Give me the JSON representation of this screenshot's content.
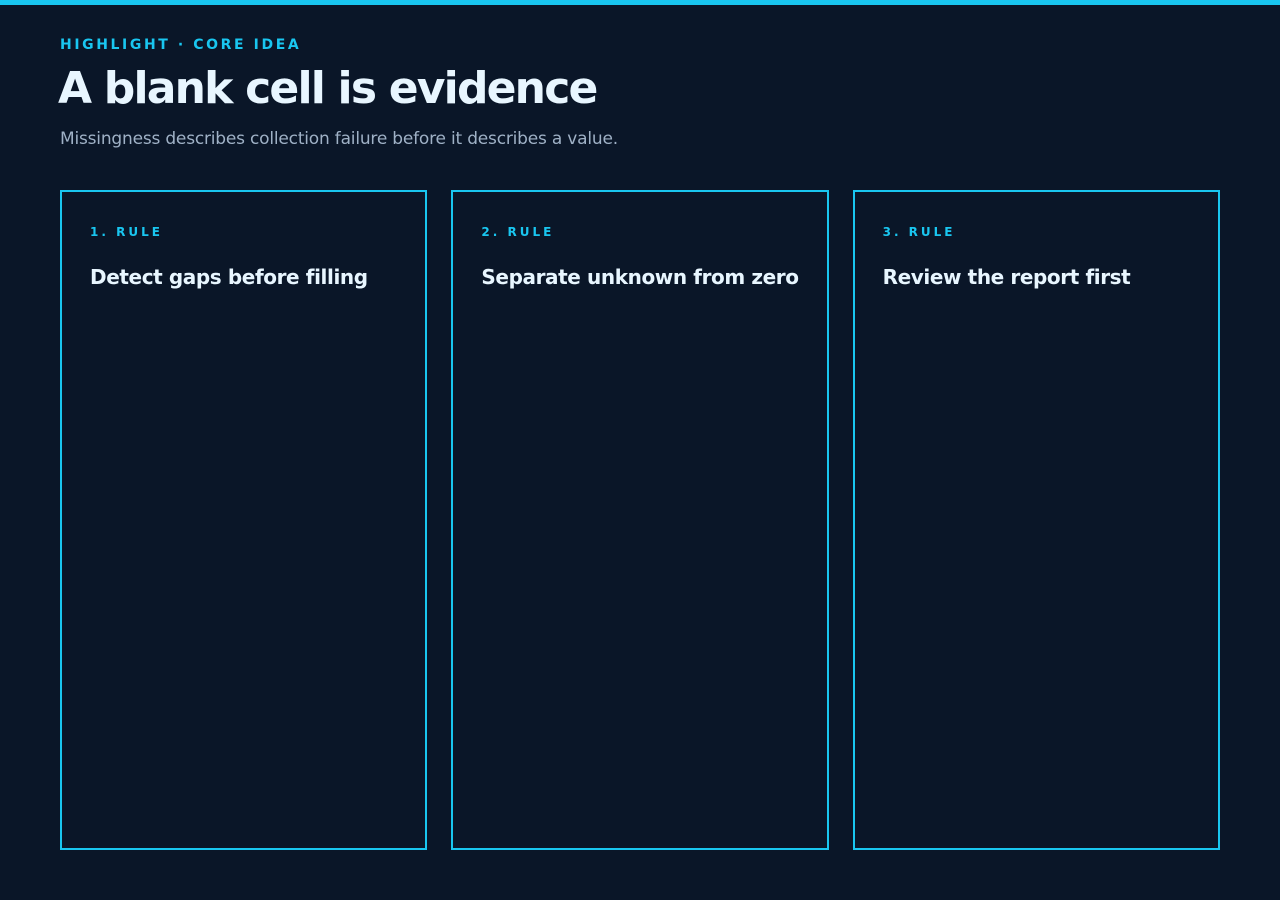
{
  "header": {
    "eyebrow": "HIGHLIGHT · CORE IDEA",
    "title": "A blank cell is evidence",
    "subtitle": "Missingness describes collection failure before it describes a value."
  },
  "cards": [
    {
      "label": "1. RULE",
      "title": "Detect gaps before filling"
    },
    {
      "label": "2. RULE",
      "title": "Separate unknown from zero"
    },
    {
      "label": "3. RULE",
      "title": "Review the report first"
    }
  ],
  "colors": {
    "background": "#0a1628",
    "accent": "#19c6f0",
    "heading": "#e8f6ff",
    "muted": "#9fb1c6"
  }
}
